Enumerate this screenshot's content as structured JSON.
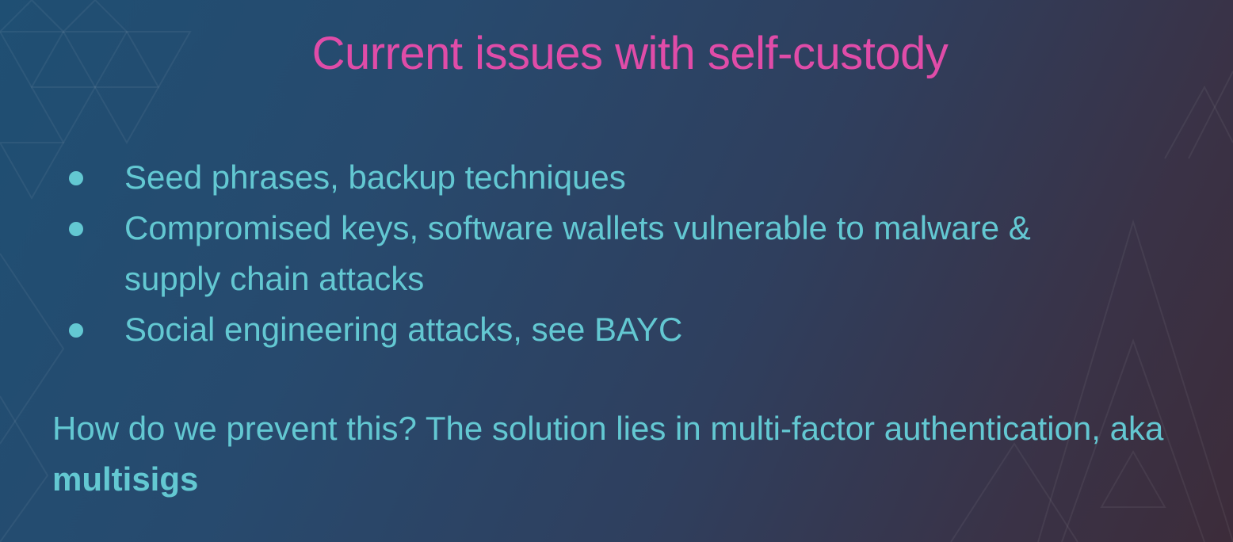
{
  "slide": {
    "title": "Current issues with self-custody",
    "bullets": [
      {
        "text": "Seed phrases, backup techniques"
      },
      {
        "text": "Compromised keys, software wallets vulnerable to malware & supply chain attacks"
      },
      {
        "text": "Social engineering attacks, see BAYC"
      }
    ],
    "conclusion": {
      "text": "How do we prevent this? The solution lies in multi-factor authentication, aka ",
      "emphasis": "multisigs"
    }
  },
  "colors": {
    "title": "#e04ca8",
    "body_text": "#63c8d2",
    "background_start": "#1f4f73",
    "background_end": "#3c2c3a"
  }
}
